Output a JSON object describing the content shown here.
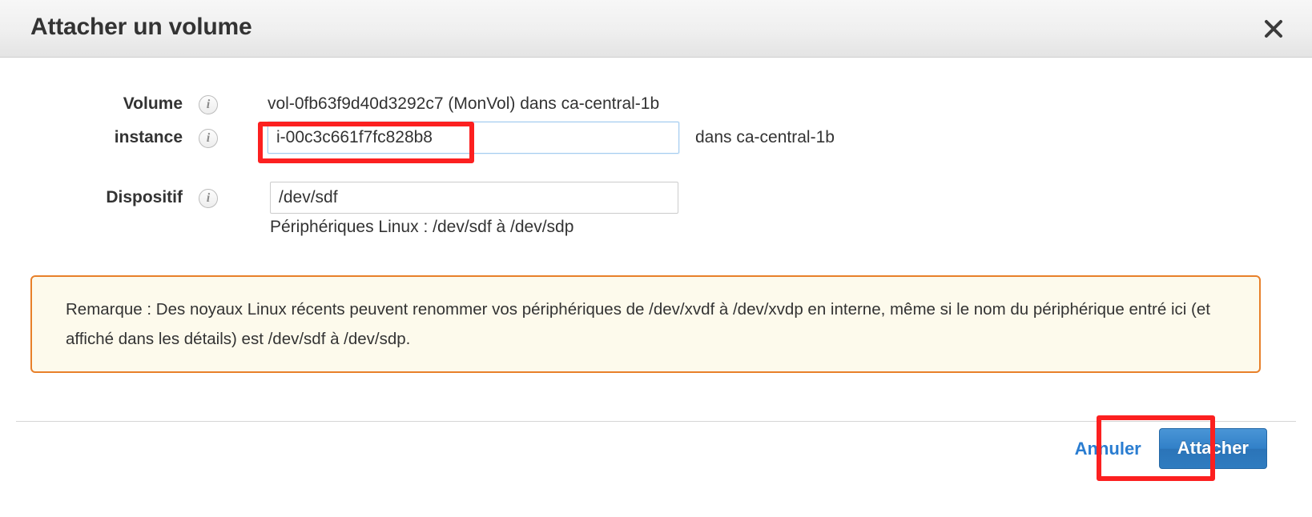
{
  "modal": {
    "title": "Attacher un volume",
    "close_icon": "close-icon",
    "fields": [
      {
        "label": "Volume",
        "info_icon": "info-icon",
        "value": "vol-0fb63f9d40d3292c7 (MonVol) dans ca-central-1b",
        "type": "static"
      },
      {
        "label": "instance",
        "info_icon": "info-icon",
        "value": "i-00c3c661f7fc828b8",
        "placeholder": "",
        "suffix": "dans ca-central-1b",
        "type": "input"
      },
      {
        "label": "Dispositif",
        "info_icon": "info-icon",
        "value": "/dev/sdf",
        "placeholder": "",
        "helper": "Périphériques Linux : /dev/sdf à /dev/sdp",
        "type": "input"
      }
    ],
    "note": {
      "text": "Remarque : Des noyaux Linux récents peuvent renommer vos périphériques de /dev/xvdf à /dev/xvdp en interne, même si le nom du périphérique entré ici (et affiché dans les détails) est /dev/sdf à /dev/sdp.",
      "border_color": "#e8802a",
      "background_color": "#fdfaec"
    },
    "footer": {
      "cancel_label": "Annuler",
      "submit_label": "Attacher",
      "submit_color": "#3180c8",
      "cancel_color": "#2a7dd1"
    },
    "annotations": {
      "color": "#fc2020",
      "targets": [
        "instance-input",
        "attach-button"
      ]
    }
  }
}
